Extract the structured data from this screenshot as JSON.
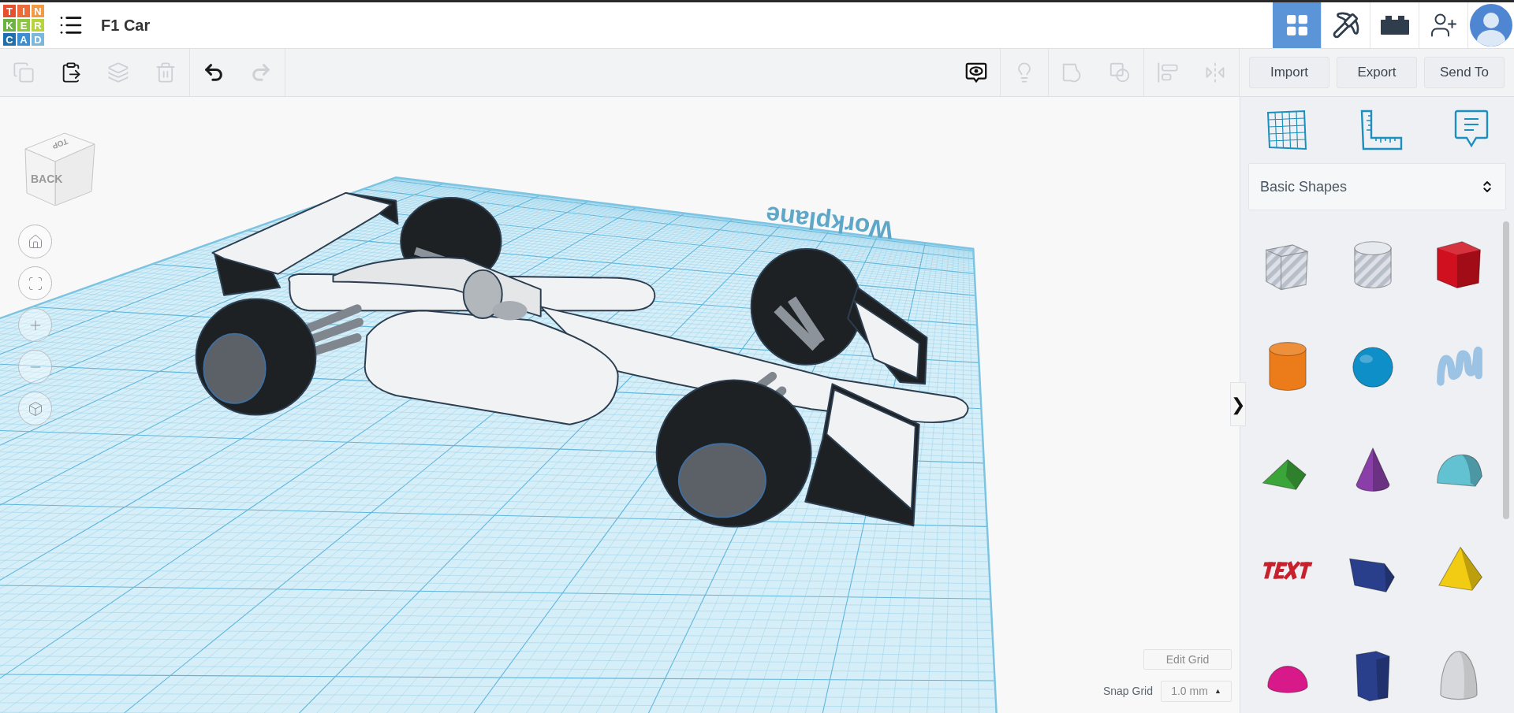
{
  "header": {
    "logo": [
      {
        "char": "T",
        "color": "#e5512f"
      },
      {
        "char": "I",
        "color": "#ec6b3b"
      },
      {
        "char": "N",
        "color": "#f39a45"
      },
      {
        "char": "K",
        "color": "#6cb33f"
      },
      {
        "char": "E",
        "color": "#8ec63f"
      },
      {
        "char": "R",
        "color": "#b7d43d"
      },
      {
        "char": "C",
        "color": "#1f6fad"
      },
      {
        "char": "A",
        "color": "#3b8fd0"
      },
      {
        "char": "D",
        "color": "#79b8dd"
      }
    ],
    "title": "F1 Car",
    "views": [
      {
        "kind": "grid",
        "selected": true
      },
      {
        "kind": "pickaxe",
        "selected": false
      },
      {
        "kind": "brick",
        "selected": false
      }
    ]
  },
  "toolbar": {
    "edit_tools": [
      {
        "kind": "copy",
        "disabled": true
      },
      {
        "kind": "paste",
        "disabled": false
      },
      {
        "kind": "duplicate",
        "disabled": true
      },
      {
        "kind": "delete",
        "disabled": true
      }
    ],
    "history": [
      {
        "kind": "undo",
        "disabled": false
      },
      {
        "kind": "redo",
        "disabled": true
      }
    ],
    "shape_tools": [
      {
        "kind": "notes",
        "disabled": false
      },
      {
        "kind": "light",
        "disabled": true
      },
      {
        "kind": "group",
        "disabled": true
      },
      {
        "kind": "ungroup",
        "disabled": true
      },
      {
        "kind": "align",
        "disabled": true
      },
      {
        "kind": "mirror",
        "disabled": true
      }
    ],
    "buttons": [
      "Import",
      "Export",
      "Send To"
    ]
  },
  "view_cube": {
    "top": "TOP",
    "front": "BACK"
  },
  "workplane": {
    "label": "Workplane"
  },
  "grid_controls": {
    "edit_button": "Edit Grid",
    "snap_label": "Snap Grid",
    "snap_value": "1.0 mm",
    "snap_caret": "▲"
  },
  "collapse_handle": "❯",
  "panel": {
    "category": "Basic Shapes",
    "shapes": [
      {
        "kind": "box-hole",
        "color": "#c9ced6"
      },
      {
        "kind": "cylinder-hole",
        "color": "#c9ced6"
      },
      {
        "kind": "box",
        "color": "#d0101e"
      },
      {
        "kind": "cylinder",
        "color": "#ec7c1a"
      },
      {
        "kind": "sphere",
        "color": "#0f8fc8"
      },
      {
        "kind": "scribble",
        "color": "#9cc3e4"
      },
      {
        "kind": "roof",
        "color": "#3ba53a"
      },
      {
        "kind": "cone",
        "color": "#8a3fa8"
      },
      {
        "kind": "round-roof",
        "color": "#62c2d2"
      },
      {
        "kind": "text",
        "color": "#c8202c"
      },
      {
        "kind": "wedge",
        "color": "#2a3f8c"
      },
      {
        "kind": "pyramid",
        "color": "#f2cc12"
      },
      {
        "kind": "half-sphere",
        "color": "#d8198a"
      },
      {
        "kind": "polygon",
        "color": "#2a3f8c"
      },
      {
        "kind": "paraboloid",
        "color": "#d6d8db"
      }
    ]
  }
}
